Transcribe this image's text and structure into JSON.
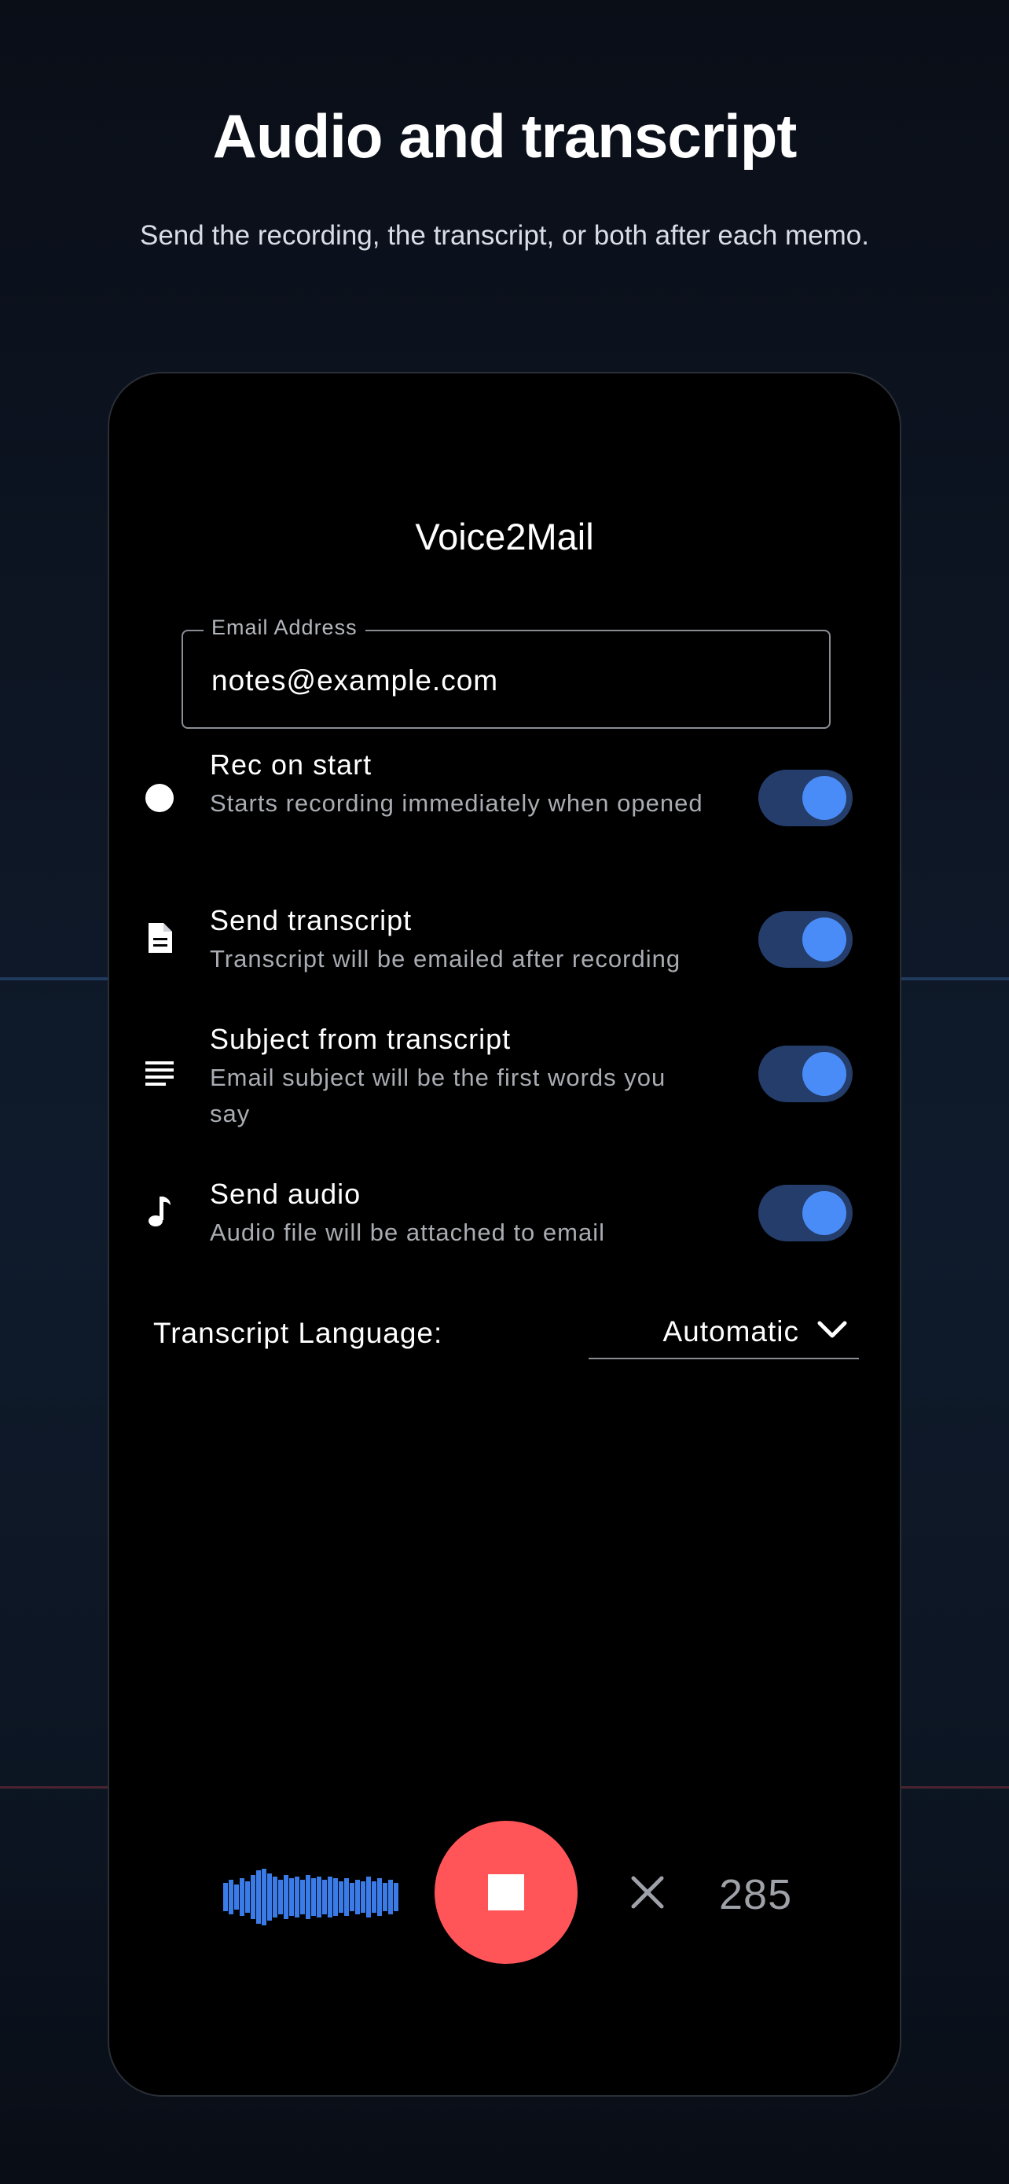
{
  "promo": {
    "title": "Audio and transcript",
    "subtitle": "Send the recording, the transcript, or both after each memo."
  },
  "app": {
    "title": "Voice2Mail",
    "email": {
      "label": "Email Address",
      "value": "notes@example.com"
    },
    "settings": [
      {
        "icon": "circle-icon",
        "title": "Rec on start",
        "description": "Starts recording immediately when opened",
        "enabled": true
      },
      {
        "icon": "document-icon",
        "title": "Send transcript",
        "description": "Transcript will be emailed after recording",
        "enabled": true
      },
      {
        "icon": "text-lines-icon",
        "title": "Subject from transcript",
        "description": "Email subject will be the first words you say",
        "enabled": true
      },
      {
        "icon": "music-note-icon",
        "title": "Send audio",
        "description": "Audio file will be attached to email",
        "enabled": true
      }
    ],
    "language": {
      "label": "Transcript Language:",
      "value": "Automatic"
    },
    "recorder": {
      "counter": "285"
    }
  },
  "colors": {
    "background": "#0d1523",
    "phone_background": "#000000",
    "toggle_track": "#243d6a",
    "toggle_knob": "#4a8cf7",
    "stop_button": "#ff5558",
    "waveform": "#3b7be8"
  }
}
